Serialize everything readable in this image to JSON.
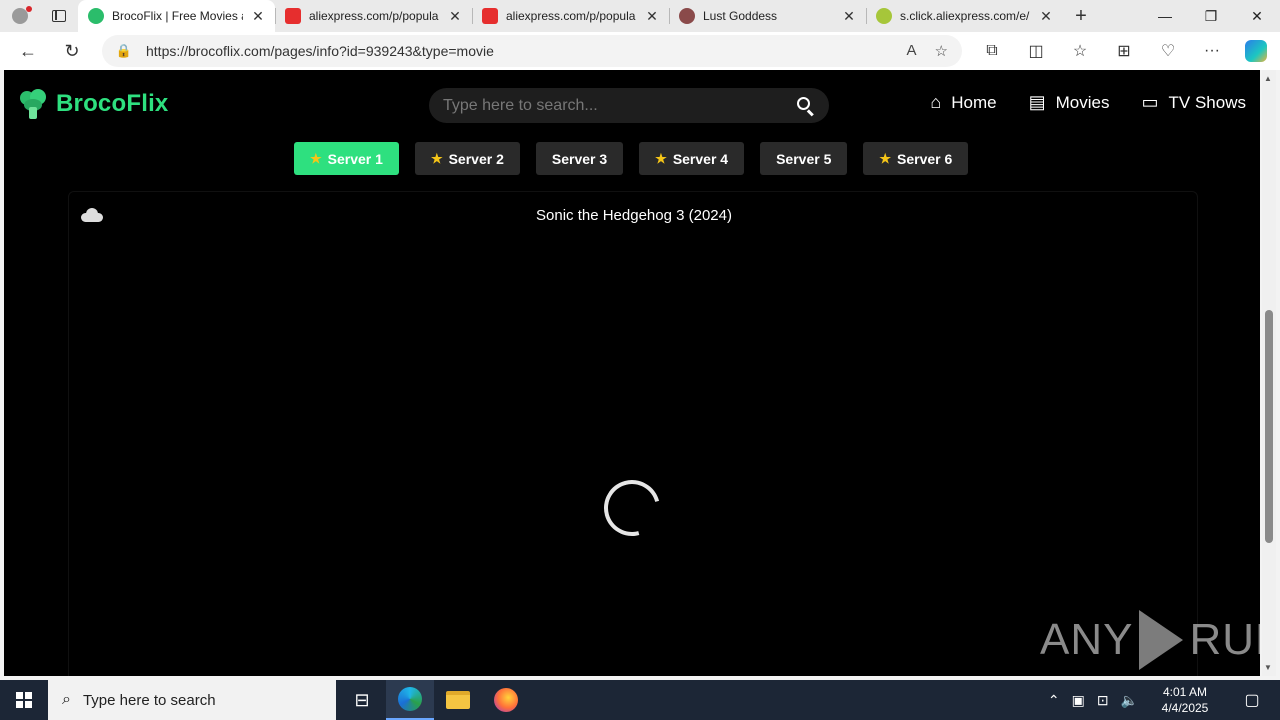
{
  "browser": {
    "tabs": [
      {
        "title": "BrocoFlix | Free Movies and",
        "favicon_color": "#2bbd6b",
        "active": true
      },
      {
        "title": "aliexpress.com/p/popula",
        "favicon_color": "#e62e2e",
        "active": false
      },
      {
        "title": "aliexpress.com/p/popula",
        "favicon_color": "#e62e2e",
        "active": false
      },
      {
        "title": "Lust Goddess",
        "favicon_color": "#8a4a4a",
        "active": false
      },
      {
        "title": "s.click.aliexpress.com/e/",
        "favicon_color": "#a6c63a",
        "active": false
      }
    ],
    "url": "https://brocoflix.com/pages/info?id=939243&type=movie"
  },
  "site": {
    "brand": "BrocoFlix",
    "brand_color": "#2ee07f",
    "search_placeholder": "Type here to search...",
    "nav": [
      {
        "label": "Home",
        "icon": "home-icon"
      },
      {
        "label": "Movies",
        "icon": "film-icon"
      },
      {
        "label": "TV Shows",
        "icon": "tv-icon"
      }
    ],
    "servers": [
      {
        "label": "Server 1",
        "star": true,
        "active": true
      },
      {
        "label": "Server 2",
        "star": true,
        "active": false
      },
      {
        "label": "Server 3",
        "star": false,
        "active": false
      },
      {
        "label": "Server 4",
        "star": true,
        "active": false
      },
      {
        "label": "Server 5",
        "star": false,
        "active": false
      },
      {
        "label": "Server 6",
        "star": true,
        "active": false
      }
    ],
    "player_title": "Sonic the Hedgehog 3 (2024)"
  },
  "watermark": {
    "left": "ANY",
    "right": "RUN"
  },
  "taskbar": {
    "search_placeholder": "Type here to search",
    "time": "4:01 AM",
    "date": "4/4/2025"
  }
}
